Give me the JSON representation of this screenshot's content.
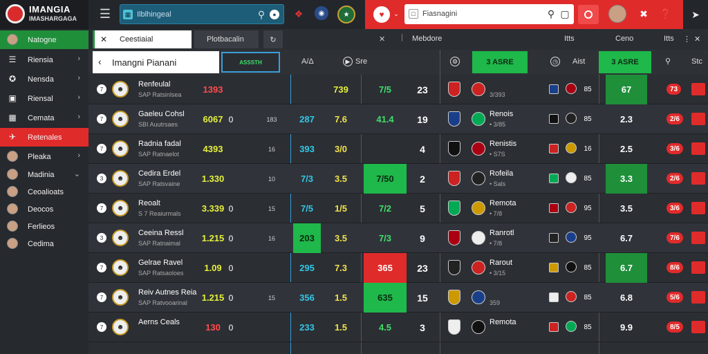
{
  "app": {
    "logo_title": "IMANGIA",
    "logo_subtitle": "IMASHARGAGA"
  },
  "topbar": {
    "search_placeholder": "Ilblhingeal",
    "search2_placeholder": "Fiasnagini"
  },
  "sidebar": {
    "items": [
      {
        "label": "Natogne",
        "icon": "person-icon",
        "chevron": false
      },
      {
        "label": "Riensia",
        "icon": "list-icon",
        "chevron": true
      },
      {
        "label": "Nensda",
        "icon": "network-icon",
        "chevron": true
      },
      {
        "label": "Riensal",
        "icon": "box-icon",
        "chevron": true
      },
      {
        "label": "Cemata",
        "icon": "calendar-icon",
        "chevron": true
      },
      {
        "label": "Retenales",
        "icon": "car-icon",
        "chevron": false
      },
      {
        "label": "Pleaka",
        "icon": "avatar",
        "chevron": true
      },
      {
        "label": "Madinia",
        "icon": "avatar",
        "chevron": true
      },
      {
        "label": "Ceoalioats",
        "icon": "avatar",
        "chevron": false
      },
      {
        "label": "Deocos",
        "icon": "avatar",
        "chevron": false
      },
      {
        "label": "Ferlieos",
        "icon": "avatar",
        "chevron": false
      },
      {
        "label": "Cedima",
        "icon": "avatar",
        "chevron": false
      }
    ]
  },
  "subbar": {
    "tab1": "Ceestiaial",
    "tab2": "Plotbacalin",
    "tab3": "Mebdore",
    "right1": "Itts",
    "right2": "Ceno",
    "right3": "Itts"
  },
  "header": {
    "breadcrumb": "Imangni Pianani",
    "button": "ASSSTH",
    "col1": "A/Δ",
    "col2": "Sre",
    "green_btn1": "3 ASRE",
    "col3": "Aist",
    "green_btn2": "3 ASRE",
    "col4": "Stc"
  },
  "rows": [
    {
      "num": "7",
      "name": "Renfeulal",
      "sub": "SAP Ratsinlsea",
      "score": "1393",
      "score_color": "r",
      "val_a": "",
      "val_b": "",
      "val_c": "",
      "odd1": "739",
      "odd1c": "yg",
      "odd2": "7/5",
      "odd2c": "g",
      "rank": "23",
      "team": "",
      "team_sub": "3/393",
      "m1": "85",
      "m2": "67",
      "m3": "73"
    },
    {
      "num": "7",
      "name": "Gaeleu Cohsl",
      "sub": "SBI Auutrsaes",
      "score": "6067",
      "score_color": "yg",
      "val_a": "0",
      "val_b": "183",
      "val_c": "287",
      "odd1": "7.6",
      "odd1c": "y",
      "odd2": "41.4",
      "odd2c": "g",
      "rank": "19",
      "team": "Renois",
      "team_sub": "• 3/85",
      "m1": "85",
      "m2": "2.3",
      "m3": "2/6"
    },
    {
      "num": "7",
      "name": "Radnia fadal",
      "sub": "SAP Ratnaelot",
      "score": "4393",
      "score_color": "yg",
      "val_a": "",
      "val_b": "16",
      "val_c": "393",
      "odd1": "3/0",
      "odd1c": "y",
      "odd2": "",
      "odd2c": "g",
      "rank": "4",
      "team": "Renistis",
      "team_sub": "• S7S",
      "m1": "16",
      "m2": "2.5",
      "m3": "3/6"
    },
    {
      "num": "3",
      "name": "Cedira Erdel",
      "sub": "SAP Ratsvaine",
      "score": "1.330",
      "score_color": "yg",
      "val_a": "",
      "val_b": "10",
      "val_c": "7/3",
      "odd1": "3.5",
      "odd1c": "y",
      "odd2": "7/50",
      "odd2c": "g",
      "rank": "2",
      "team": "Rofeila",
      "team_sub": "• Sals",
      "m1": "85",
      "m2": "3.3",
      "m3": "2/6"
    },
    {
      "num": "7",
      "name": "Reoalt",
      "sub": "S 7 Reaiurmals",
      "score": "3.339",
      "score_color": "yg",
      "val_a": "0",
      "val_b": "15",
      "val_c": "7/5",
      "odd1": "1/5",
      "odd1c": "y",
      "odd2": "7/2",
      "odd2c": "g",
      "rank": "5",
      "team": "Remota",
      "team_sub": "• 7/8",
      "m1": "95",
      "m2": "3.5",
      "m3": "3/6"
    },
    {
      "num": "3",
      "name": "Ceeina Ressl",
      "sub": "SAP Ratnaimal",
      "score": "1.215",
      "score_color": "yg",
      "val_a": "0",
      "val_b": "16",
      "val_c": "203",
      "odd1": "3.5",
      "odd1c": "y",
      "odd2": "7/3",
      "odd2c": "g",
      "rank": "9",
      "team": "Ranrotl",
      "team_sub": "• 7/8",
      "m1": "95",
      "m2": "6.7",
      "m3": "7/6"
    },
    {
      "num": "7",
      "name": "Gelrae Ravel",
      "sub": "SAP Ratsaoloes",
      "score": "1.09",
      "score_color": "yg",
      "val_a": "0",
      "val_b": "",
      "val_c": "295",
      "odd1": "7.3",
      "odd1c": "y",
      "odd2": "365",
      "odd2c": "r",
      "rank": "23",
      "team": "Rarout",
      "team_sub": "• 3/15",
      "m1": "85",
      "m2": "6.7",
      "m3": "8/6"
    },
    {
      "num": "7",
      "name": "Reiv Autnes Reia",
      "sub": "SAP Ratvooarinal",
      "score": "1.215",
      "score_color": "yg",
      "val_a": "0",
      "val_b": "15",
      "val_c": "356",
      "odd1": "1.5",
      "odd1c": "y",
      "odd2": "635",
      "odd2c": "g",
      "rank": "15",
      "team": "",
      "team_sub": "359",
      "m1": "85",
      "m2": "6.8",
      "m3": "5/6"
    },
    {
      "num": "7",
      "name": "Aerns Ceals",
      "sub": "",
      "score": "130",
      "score_color": "r",
      "val_a": "0",
      "val_b": "",
      "val_c": "233",
      "odd1": "1.5",
      "odd1c": "y",
      "odd2": "4.5",
      "odd2c": "g",
      "rank": "3",
      "team": "Remota",
      "team_sub": "",
      "m1": "85",
      "m2": "9.9",
      "m3": "8/5"
    }
  ]
}
